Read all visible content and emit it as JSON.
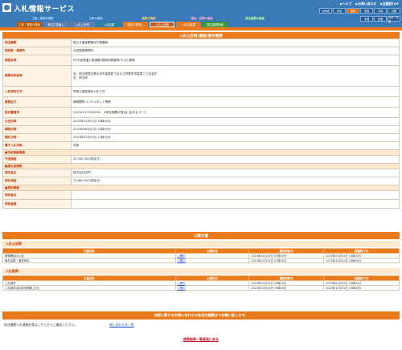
{
  "header": {
    "title": "入札情報サービス",
    "links": [
      "▶ヘルプ",
      "▶お問い合わせ",
      "▶全国版TOP"
    ],
    "regions_row1": [
      "北海道",
      "東北",
      "関東",
      "北陸",
      "中部",
      "近畿"
    ],
    "regions_row2": [
      "中国",
      "四国",
      "九州・沖縄"
    ],
    "nav_labels": [
      "工事の検索",
      "業務の検索",
      "物品・役務の検索",
      "発注機関の検索"
    ],
    "nav_prefix": "工事・業務の検索",
    "tabs": [
      "工事・業務の検索",
      "発注の見通し",
      "入札公告等",
      "入札結果",
      "発注の見通し",
      "入札公告等",
      "入札の結果",
      "発注機関情報"
    ]
  },
  "detail": {
    "section_title": "入札公告等(業務)案件概要",
    "rows": [
      {
        "key": "発注機関",
        "value": "国土交通省関東地方整備局"
      },
      {
        "key": "契約部・事務所",
        "value": "大宮国道事務所"
      },
      {
        "key": "業務名称",
        "value": "R5大宮国道上尾道路2期用地調査等(その2)業務"
      },
      {
        "key": "業務対象地域",
        "value": "自：埼玉県埼玉県北本市高尾四丁目から同県同市高尾三丁目会先\n至：埼玉県"
      },
      {
        "key": "入札契約方式",
        "value": "簡易公募型競争入札方式"
      },
      {
        "key": "業務区分",
        "value": "補償関係コンサルタント業務"
      },
      {
        "key": "設計書番号",
        "value": "202301472020000　※発注機関が独自に定めるコード"
      },
      {
        "key": "公告日時",
        "value": "2023年01月22日 16時00分"
      },
      {
        "key": "期限日時",
        "value": "2023年06月01日 15時00分"
      },
      {
        "key": "開札日時",
        "value": "2023年07月15日 11時00分"
      },
      {
        "key": "電子入札対象",
        "value": "対象"
      }
    ],
    "estimate_group": "■予定価格情報",
    "estimate_rows": [
      {
        "key": "予定価格",
        "value": "30,200,000(税抜き)"
      }
    ],
    "winner_group": "■落札者情報",
    "winner_rows": [
      {
        "key": "落札者名",
        "value": "株式会社四門"
      },
      {
        "key": "落札価格",
        "value": "23,860,000(税抜き)"
      }
    ],
    "contract_group": "■契約情報",
    "contract_rows": [
      {
        "key": "契約者名",
        "value": ""
      },
      {
        "key": "契約金額",
        "value": ""
      }
    ]
  },
  "documents": {
    "title": "公開文書",
    "headers": [
      "文書名称",
      "公開状況",
      "最終更新日",
      "掲載終了日"
    ],
    "notice_group": "入札公告等",
    "notice_rows": [
      [
        "業務開始の公告",
        "公開中",
        "2023年01月22日 07時00分",
        "2023年03月31日 23時00分"
      ],
      [
        "落札結果・選択資料",
        "公開中",
        "2023年07月25日 07時00分",
        "2023年10月31日 23時00分"
      ]
    ],
    "result_group": "入札結果",
    "result_rows": [
      [
        "入札調書",
        "公開中",
        "2023年07月24日 10時00分",
        "2023年01月31日 23時00分"
      ],
      [
        "入札調書(総合評価落札方式)",
        "公開中",
        "2023年07月24日 10時00分",
        "2023年10月31日 23時00分"
      ]
    ]
  },
  "footer": {
    "notice": "内容に関するお問い合わせは各発注機関までお願い致します。",
    "contact_text": "発注機関への連絡先等はこちらからご確認ください。",
    "contact_link": "問い合わせ先一覧",
    "back_link": "検索結果一覧画面に戻る"
  }
}
